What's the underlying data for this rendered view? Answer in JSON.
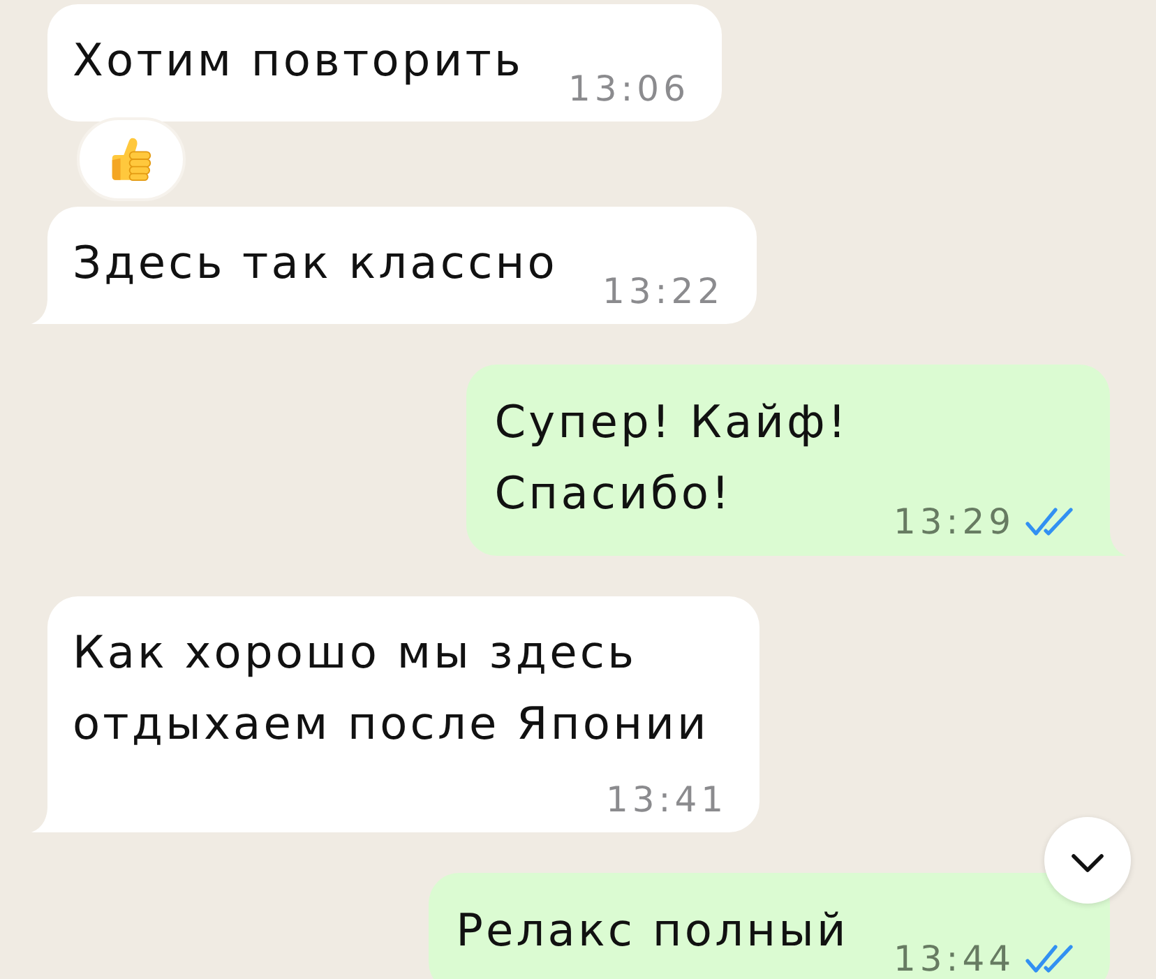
{
  "messages": [
    {
      "kind": "incoming",
      "text": "Хотим повторить",
      "time": "13:06",
      "tail": false,
      "reaction": true
    },
    {
      "kind": "incoming",
      "text": "Здесь так классно",
      "time": "13:22",
      "tail": true,
      "reaction": false
    },
    {
      "kind": "outgoing",
      "text": "Супер! Кайф!\nСпасибо!",
      "time": "13:29",
      "tail": true,
      "reaction": false,
      "read": true
    },
    {
      "kind": "incoming",
      "text": "Как хорошо мы здесь отдыхаем после Японии",
      "time": "13:41",
      "tail": true,
      "reaction": false
    },
    {
      "kind": "outgoing",
      "text": "Релакс полный",
      "time": "13:44",
      "tail": false,
      "reaction": false,
      "read": true
    }
  ],
  "scroll_down_button": true
}
